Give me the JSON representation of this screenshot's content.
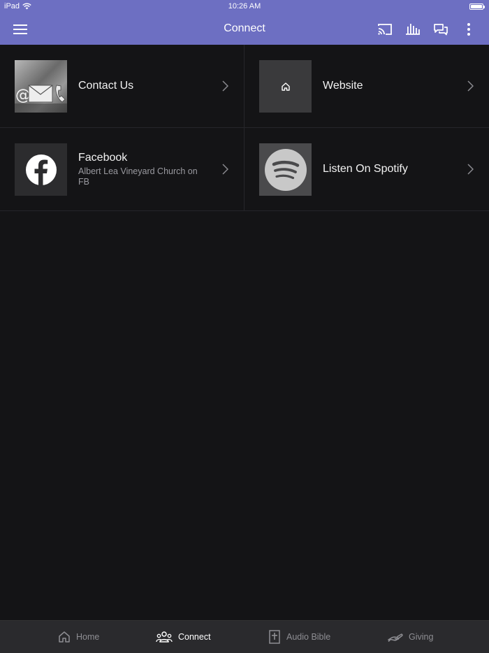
{
  "status_bar": {
    "carrier": "iPad",
    "time": "10:26 AM"
  },
  "nav": {
    "title": "Connect",
    "icons": [
      "menu-icon",
      "cast-icon",
      "audio-bars-icon",
      "chat-icon",
      "more-vertical-icon"
    ]
  },
  "items": [
    {
      "title": "Contact Us",
      "subtitle": "",
      "thumb": "contact-image"
    },
    {
      "title": "Website",
      "subtitle": "",
      "thumb": "home-icon"
    },
    {
      "title": "Facebook",
      "subtitle": "Albert Lea Vineyard Church on FB",
      "thumb": "facebook-icon"
    },
    {
      "title": "Listen On Spotify",
      "subtitle": "",
      "thumb": "spotify-icon"
    }
  ],
  "tabs": [
    {
      "label": "Home",
      "icon": "home-icon",
      "active": false
    },
    {
      "label": "Connect",
      "icon": "people-icon",
      "active": true
    },
    {
      "label": "Audio Bible",
      "icon": "bible-icon",
      "active": false
    },
    {
      "label": "Giving",
      "icon": "giving-icon",
      "active": false
    }
  ],
  "colors": {
    "accent": "#6d6fc2",
    "background": "#141416",
    "tabbar": "#2a2a2d"
  }
}
